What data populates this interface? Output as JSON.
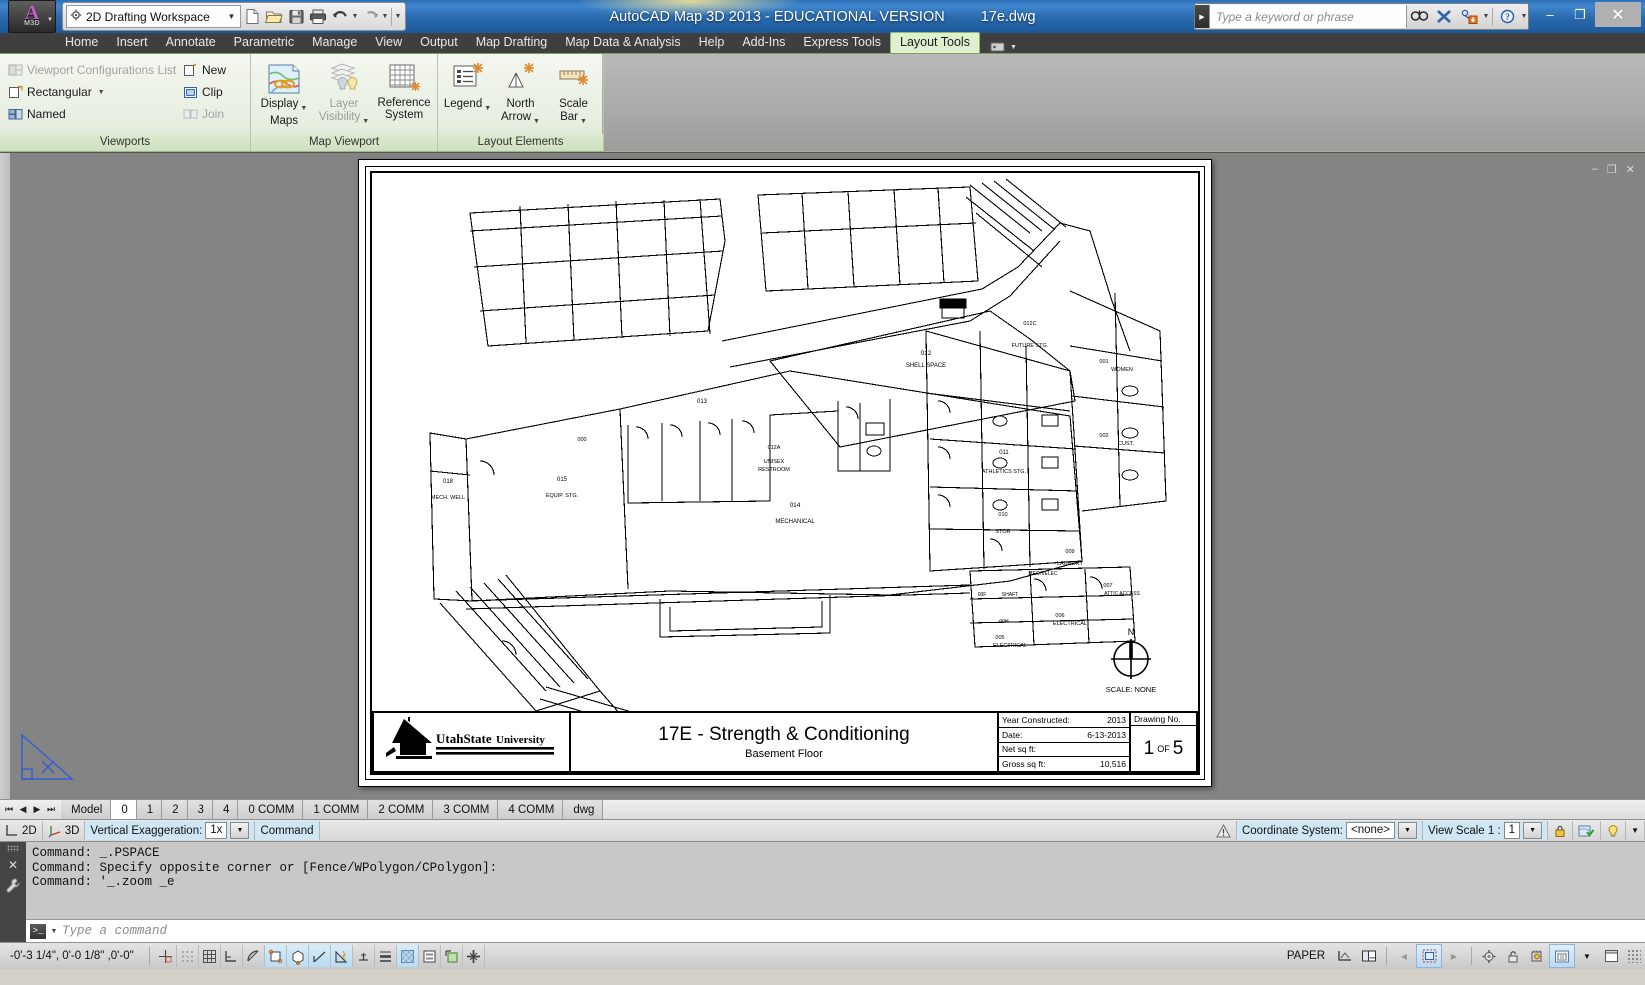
{
  "titlebar": {
    "app_title": "AutoCAD Map 3D 2013 - EDUCATIONAL VERSION",
    "document": "17e.dwg",
    "workspace": "2D Drafting Workspace",
    "search_placeholder": "Type a keyword or phrase",
    "minimize": "–",
    "maximize": "❐",
    "close": "✕",
    "quick_access": [
      {
        "name": "new-file-icon",
        "label": "New"
      },
      {
        "name": "open-file-icon",
        "label": "Open"
      },
      {
        "name": "save-icon",
        "label": "Save"
      },
      {
        "name": "plot-icon",
        "label": "Plot"
      },
      {
        "name": "undo-icon",
        "label": "Undo"
      },
      {
        "name": "redo-icon",
        "label": "Redo"
      }
    ]
  },
  "ribbon": {
    "tabs": [
      {
        "label": "Home",
        "active": false
      },
      {
        "label": "Insert",
        "active": false
      },
      {
        "label": "Annotate",
        "active": false
      },
      {
        "label": "Parametric",
        "active": false
      },
      {
        "label": "Manage",
        "active": false
      },
      {
        "label": "View",
        "active": false
      },
      {
        "label": "Output",
        "active": false
      },
      {
        "label": "Map Drafting",
        "active": false
      },
      {
        "label": "Map Data & Analysis",
        "active": false
      },
      {
        "label": "Help",
        "active": false
      },
      {
        "label": "Add-Ins",
        "active": false
      },
      {
        "label": "Express Tools",
        "active": false
      },
      {
        "label": "Layout Tools",
        "active": true
      }
    ],
    "panels": [
      {
        "title": "Viewports",
        "small_items": [
          {
            "label": "Viewport Configurations List",
            "icon": "viewport-config-icon",
            "disabled": true,
            "dropdown": true
          },
          {
            "label": "Rectangular",
            "icon": "rectangular-viewport-icon",
            "disabled": false,
            "dropdown": true
          },
          {
            "label": "Named",
            "icon": "named-viewport-icon",
            "disabled": false,
            "dropdown": false
          },
          {
            "label": "New",
            "icon": "new-viewport-icon",
            "disabled": false,
            "dropdown": false
          },
          {
            "label": "Clip",
            "icon": "clip-viewport-icon",
            "disabled": false,
            "dropdown": false
          },
          {
            "label": "Join",
            "icon": "join-viewport-icon",
            "disabled": true,
            "dropdown": false
          }
        ]
      },
      {
        "title": "Map Viewport",
        "big_items": [
          {
            "label1": "Display",
            "label2": "Maps",
            "icon": "display-maps-icon",
            "disabled": false,
            "dropdown": true
          },
          {
            "label1": "Layer",
            "label2": "Visibility",
            "icon": "layer-visibility-icon",
            "disabled": true,
            "dropdown": true
          },
          {
            "label1": "Reference",
            "label2": "System",
            "icon": "reference-system-icon",
            "disabled": false,
            "dropdown": false
          }
        ]
      },
      {
        "title": "Layout Elements",
        "big_items": [
          {
            "label1": "Legend",
            "label2": "",
            "icon": "legend-icon",
            "disabled": false,
            "dropdown": true
          },
          {
            "label1": "North",
            "label2": "Arrow",
            "icon": "north-arrow-icon",
            "disabled": false,
            "dropdown": true
          },
          {
            "label1": "Scale",
            "label2": "Bar",
            "icon": "scale-bar-icon",
            "disabled": false,
            "dropdown": true
          }
        ]
      }
    ]
  },
  "drawing": {
    "viewport_controls": {
      "minimize": "–",
      "restore": "❐",
      "close": "✕"
    },
    "north_arrow": {
      "label": "N",
      "scale": "SCALE: NONE"
    },
    "title_block": {
      "logo_text": "UtahStateUniversity",
      "title": "17E - Strength & Conditioning",
      "subtitle": "Basement Floor",
      "fields": [
        {
          "label": "Year Constructed:",
          "value": "2013"
        },
        {
          "label": "Date:",
          "value": "6-13-2013"
        },
        {
          "label": "Net sq ft:",
          "value": ""
        },
        {
          "label": "Gross sq ft:",
          "value": "10,516"
        }
      ],
      "drawing_no_label": "Drawing No.",
      "sheet_number": "1",
      "sheet_of": "OF",
      "sheet_total": "5"
    },
    "room_labels": [
      {
        "number": "012",
        "name": "SHELL SPACE"
      },
      {
        "number": "013",
        "name": ""
      },
      {
        "number": "012A",
        "name": "UNISEX RESTROOM"
      },
      {
        "number": "012C",
        "name": "FUTURE STG."
      },
      {
        "number": "011",
        "name": "ATHLETICS STG."
      },
      {
        "number": "010",
        "name": "STOR"
      },
      {
        "number": "014",
        "name": "MECHANICAL"
      },
      {
        "number": "015",
        "name": "EQUIP. STG."
      },
      {
        "number": "018",
        "name": "MECH. WELL"
      },
      {
        "number": "000",
        "name": ""
      },
      {
        "number": "001",
        "name": "WOMEN"
      },
      {
        "number": "002",
        "name": "CUST."
      },
      {
        "number": "009",
        "name": "LAUNDRY"
      },
      {
        "number": "007",
        "name": "ATTIC ACCESS/STOR."
      },
      {
        "number": "006",
        "name": "ELECTRICAL"
      },
      {
        "number": "005",
        "name": "ELECTRICAL"
      },
      {
        "number": "004",
        "name": ""
      },
      {
        "number": "00F",
        "name": "SHAFT"
      },
      {
        "number": "00H",
        "name": ""
      },
      {
        "number": "003",
        "name": "MECH/ELEC"
      }
    ]
  },
  "layout_tabs": {
    "nav": [
      "⏮",
      "◀",
      "▶",
      "⏭"
    ],
    "tabs": [
      {
        "label": "Model",
        "active": false
      },
      {
        "label": "0",
        "active": true
      },
      {
        "label": "1",
        "active": false
      },
      {
        "label": "2",
        "active": false
      },
      {
        "label": "3",
        "active": false
      },
      {
        "label": "4",
        "active": false
      },
      {
        "label": "0 COMM",
        "active": false
      },
      {
        "label": "1 COMM",
        "active": false
      },
      {
        "label": "2 COMM",
        "active": false
      },
      {
        "label": "3 COMM",
        "active": false
      },
      {
        "label": "4 COMM",
        "active": false
      },
      {
        "label": "dwg",
        "active": false
      }
    ]
  },
  "strip3d": {
    "mode_2d": "2D",
    "mode_3d": "3D",
    "vertical_exaggeration_label": "Vertical Exaggeration:",
    "vertical_exaggeration_value": "1x",
    "command_label": "Command",
    "coordinate_system_label": "Coordinate System:",
    "coordinate_system_value": "<none>",
    "view_scale_label": "View Scale  1 :",
    "view_scale_value": "1"
  },
  "command_line": {
    "history": [
      "Command: _.PSPACE",
      "Command: Specify opposite corner or [Fence/WPolygon/CPolygon]:",
      "Command: '_.zoom _e"
    ],
    "placeholder": "Type a command",
    "prompt_glyph": ">_"
  },
  "statusbar": {
    "coordinates": "-0'-3 1/4\",  0'-0 1/8\" ,0'-0\"",
    "space_mode": "PAPER",
    "toggles": [
      {
        "name": "infer-constraints-icon",
        "on": false
      },
      {
        "name": "snap-mode-icon",
        "on": false
      },
      {
        "name": "grid-display-icon",
        "on": false
      },
      {
        "name": "ortho-mode-icon",
        "on": false
      },
      {
        "name": "polar-tracking-icon",
        "on": false
      },
      {
        "name": "object-snap-icon",
        "on": true
      },
      {
        "name": "3d-object-snap-icon",
        "on": true
      },
      {
        "name": "object-snap-tracking-icon",
        "on": true
      },
      {
        "name": "dynamic-ucs-icon",
        "on": true
      },
      {
        "name": "dynamic-input-icon",
        "on": false
      },
      {
        "name": "lineweight-icon",
        "on": false
      },
      {
        "name": "transparency-icon",
        "on": true
      },
      {
        "name": "quick-properties-icon",
        "on": false
      },
      {
        "name": "selection-cycling-icon",
        "on": false
      },
      {
        "name": "annotation-monitor-icon",
        "on": false
      }
    ]
  }
}
